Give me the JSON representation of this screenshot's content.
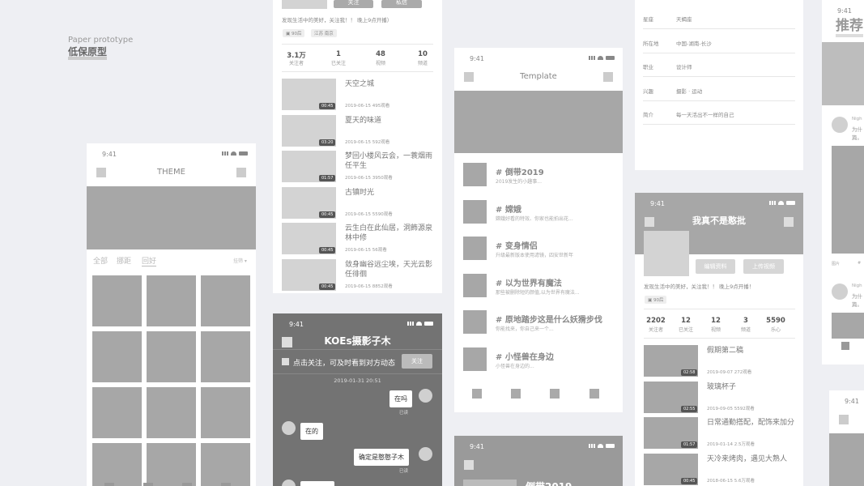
{
  "caption": {
    "en": "Paper prototype",
    "zh": "低保原型"
  },
  "status_time": "9:41",
  "theme_screen": {
    "title": "THEME",
    "tabs": [
      "全部",
      "挪距",
      "回好"
    ],
    "filter": "挂筛 ▾"
  },
  "profile_top": {
    "buttons": [
      "关注",
      "私信"
    ],
    "bio": "发现生活中的美好，关注我！！ 晚上9点开播）",
    "tags": [
      "90后",
      "江苏 南京"
    ],
    "stats": [
      {
        "n": "3.1万",
        "l": "关注者"
      },
      {
        "n": "1",
        "l": "已关注"
      },
      {
        "n": "48",
        "l": "视频"
      },
      {
        "n": "10",
        "l": "频道"
      }
    ],
    "videos": [
      {
        "title": "天空之城",
        "meta": "2019-06-15  495观看",
        "dur": "00:45"
      },
      {
        "title": "夏天的味道",
        "meta": "2019-06-15  592观看",
        "dur": "03:20"
      },
      {
        "title": "梦回小楼风云会，一蓑烟雨任平生",
        "meta": "2019-06-15  3950观看",
        "dur": "01:57"
      },
      {
        "title": "古镇时光",
        "meta": "2019-06-15  5590观看",
        "dur": "00:45"
      },
      {
        "title": "云生白在此仙居，洞飾源泉林中修",
        "meta": "2019-06-15  56观看",
        "dur": "00:45"
      },
      {
        "title": "敛身幽谷远尘埃，天光云影任徘徊",
        "meta": "2019-06-15  8852观看",
        "dur": "00:45"
      }
    ]
  },
  "chat_screen": {
    "title": "KOEs摄影子木",
    "notice": "点击关注，可及时看到对方动态",
    "follow": "关注",
    "timestamp": "2019-01-31  20:51",
    "messages": [
      {
        "text": "在吗",
        "status": "已读"
      },
      {
        "text": "在的",
        "status": ""
      },
      {
        "text": "确定是憨憨子木",
        "status": "已读"
      }
    ]
  },
  "template_screen": {
    "title": "Template",
    "topics": [
      {
        "title": "倒带2019",
        "sub": "2019发生的小趣事..."
      },
      {
        "title": "嫦娥",
        "sub": "嫦娥好看的特效、你家也能拍出花..."
      },
      {
        "title": "变身情侣",
        "sub": "升级最新版本使用滤镜，四安世新年"
      },
      {
        "title": "以为世界有魔法",
        "sub": "那些被删除短的颜值,以为世界有魔法..."
      },
      {
        "title": "原地踏步这是什么妖猾步伐",
        "sub": "你能找来，你自己来一个..."
      },
      {
        "title": "小怪兽在身边",
        "sub": "小怪兽在身边的..."
      }
    ],
    "bottom_title": "倒带2019"
  },
  "profile_info": {
    "rows": [
      {
        "label": "星座",
        "value": "天蝎座"
      },
      {
        "label": "所在地",
        "value": "中国-湖南-长沙"
      },
      {
        "label": "职业",
        "value": "设计师"
      },
      {
        "label": "兴趣",
        "value": "摄影 · 运动"
      },
      {
        "label": "简介",
        "value": "每一天活出不一样的自己"
      }
    ]
  },
  "profile_right": {
    "name": "我真不是憨批",
    "buttons": [
      "编辑资料",
      "上传视频"
    ],
    "bio": "发现生活中的美好，关注我！！ 晚上9点开播！",
    "tags": [
      "90后"
    ],
    "stats": [
      {
        "n": "2202",
        "l": "关注者"
      },
      {
        "n": "12",
        "l": "已关注"
      },
      {
        "n": "12",
        "l": "视频"
      },
      {
        "n": "3",
        "l": "频道"
      },
      {
        "n": "5590",
        "l": "乐心"
      }
    ],
    "videos": [
      {
        "title": "假期第二稿",
        "meta": "2019-09-07  272观看",
        "dur": "02:58"
      },
      {
        "title": "玻璃杯子",
        "meta": "2019-09-05  5592观看",
        "dur": "02:55"
      },
      {
        "title": "日常通勤搭配，配饰来加分",
        "meta": "2019-01-14  2.5万观看",
        "dur": "01:57"
      },
      {
        "title": "天冷来烤肉，遇见大熟人",
        "meta": "2018-06-15  5.6万观看",
        "dur": "00:45"
      }
    ]
  },
  "far_right": {
    "title": "推荐",
    "items": [
      {
        "name": "Nigh",
        "text": "为什篇。"
      },
      {
        "name": "Nigh",
        "text": "为什篇。"
      }
    ],
    "small_labels": [
      "图片",
      "#"
    ]
  }
}
